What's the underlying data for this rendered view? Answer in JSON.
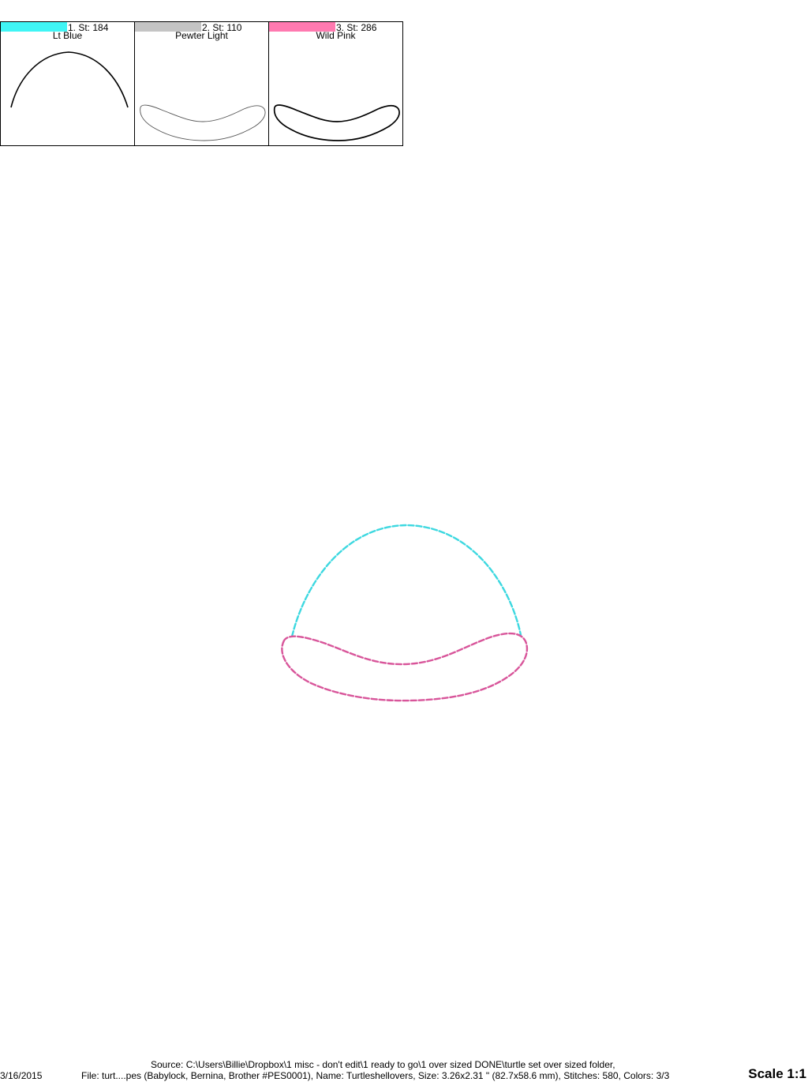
{
  "threads": [
    {
      "label": "1. St: 184",
      "name": "Lt Blue",
      "color": "#40f5f5"
    },
    {
      "label": "2. St: 110",
      "name": "Pewter Light",
      "color": "#c4c4c4"
    },
    {
      "label": "3. St: 286",
      "name": "Wild Pink",
      "color": "#ff7ab0"
    }
  ],
  "design": {
    "shell_color": "#3dd8e0",
    "brim_color": "#d8559a"
  },
  "footer": {
    "date": "3/16/2015",
    "source": "Source: C:\\Users\\Billie\\Dropbox\\1 misc - don't edit\\1 ready to go\\1 over sized DONE\\turtle set over sized folder,",
    "file": "File: turt....pes (Babylock, Bernina, Brother #PES0001), Name: Turtleshellovers, Size: 3.26x2.31 \" (82.7x58.6 mm), Stitches: 580, Colors: 3/3",
    "scale": "Scale 1:1"
  }
}
